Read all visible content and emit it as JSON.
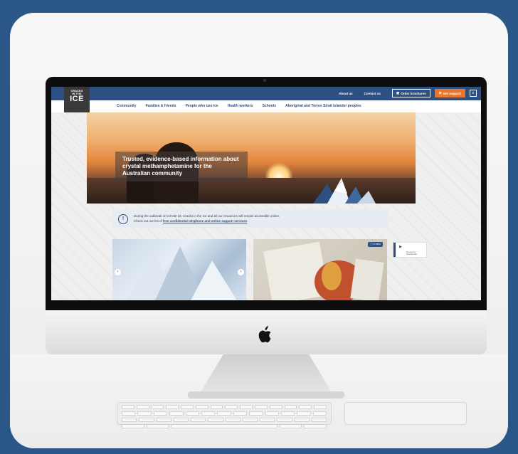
{
  "site": {
    "logo_line1": "CRACKS",
    "logo_line1b": "IN THE",
    "logo_line2": "ICE"
  },
  "topbar": {
    "about": "About us",
    "contact": "Contact us",
    "order": "Order brochures",
    "support": "Get support",
    "search_icon": "search-icon"
  },
  "nav": {
    "items": [
      "Community",
      "Families & friends",
      "People who use ice",
      "Health workers",
      "Schools",
      "Aboriginal and Torres Strait Islander peoples"
    ]
  },
  "hero": {
    "heading": "Trusted, evidence-based information about crystal methamphetamine for the Australian community"
  },
  "notice": {
    "line1": "During the outbreak of COVID-19, Cracks in the Ice and all our resources will remain accessible online.",
    "line2_prefix": "Check out our list of ",
    "line2_link": "free confidential telephone and online support services",
    "line2_suffix": "."
  },
  "cards": {
    "badge": "ⓘ 6 mins"
  },
  "audio": {
    "powered": "Powered by ReadSpeaker"
  },
  "colors": {
    "brand_blue": "#2d4f82",
    "accent_orange": "#e8762c",
    "outer_background": "#2b5688"
  }
}
